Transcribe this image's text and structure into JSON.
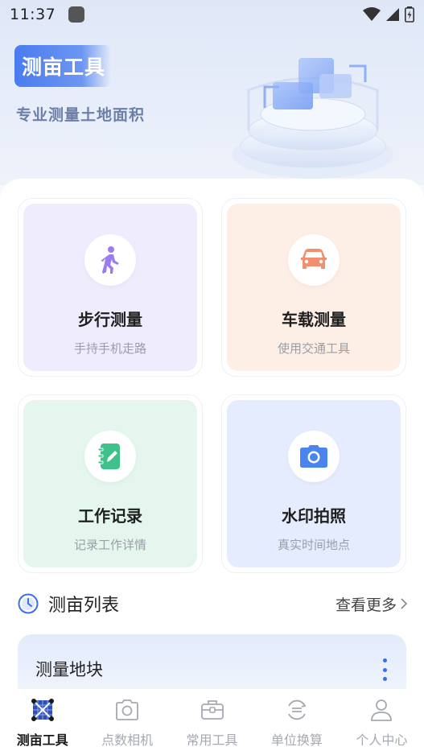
{
  "status_bar": {
    "time": "11:37"
  },
  "hero": {
    "title": "测亩工具",
    "subtitle": "专业测量土地面积"
  },
  "tools": [
    {
      "title": "步行测量",
      "subtitle": "手持手机走路",
      "icon": "walking-person-icon",
      "bg": "#eeecfd",
      "icon_color": "#9b7cf0"
    },
    {
      "title": "车载测量",
      "subtitle": "使用交通工具",
      "icon": "car-icon",
      "bg": "#fdeee6",
      "icon_color": "#f28f6e"
    },
    {
      "title": "工作记录",
      "subtitle": "记录工作详情",
      "icon": "notebook-icon",
      "bg": "#e4f6ee",
      "icon_color": "#3ec18a"
    },
    {
      "title": "水印拍照",
      "subtitle": "真实时间地点",
      "icon": "camera-icon",
      "bg": "#e5ecfd",
      "icon_color": "#4a84ee"
    }
  ],
  "list": {
    "title": "测亩列表",
    "more_label": "查看更多"
  },
  "record": {
    "title": "测量地块"
  },
  "bottom_nav": [
    {
      "label": "测亩工具",
      "icon": "grid-map-icon",
      "active": true
    },
    {
      "label": "点数相机",
      "icon": "camera-outline-icon",
      "active": false
    },
    {
      "label": "常用工具",
      "icon": "toolbox-icon",
      "active": false
    },
    {
      "label": "单位换算",
      "icon": "exchange-icon",
      "active": false
    },
    {
      "label": "个人中心",
      "icon": "person-icon",
      "active": false
    }
  ],
  "colors": {
    "accent": "#3a6fe8",
    "active_nav": "#1a1a1a",
    "inactive_nav": "#a6a9b1"
  }
}
